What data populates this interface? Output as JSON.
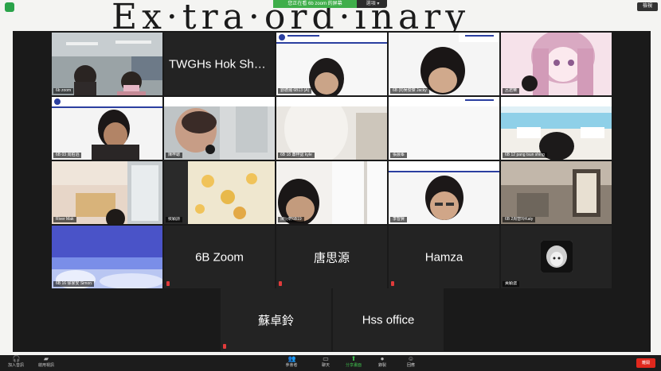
{
  "whiteboard_text": "Ex·tra·ord·inary",
  "share_bar": {
    "status": "您正在看 6b zoom 的屏幕",
    "options": "選項 ▾"
  },
  "top_right": {
    "label": "檢視"
  },
  "tiles": [
    {
      "name": "6b zoom",
      "type": "video"
    },
    {
      "name": "TWGHs Hok Shan...",
      "type": "name"
    },
    {
      "name": "劉德瀚 6B13 (A)",
      "type": "video"
    },
    {
      "name": "6B (8)吳俊傑 Jacky",
      "type": "video"
    },
    {
      "name": "呂君樂",
      "type": "video"
    },
    {
      "name": "6B 03 周柏滔",
      "type": "video"
    },
    {
      "name": "陳梓聰",
      "type": "video"
    },
    {
      "name": "6B 18 蕭梓認 kyle",
      "type": "video"
    },
    {
      "name": "張晨峯",
      "type": "video"
    },
    {
      "name": "6B 12 pang tsun shing",
      "type": "video"
    },
    {
      "name": "River Mak",
      "type": "video"
    },
    {
      "name": "侯穎詩",
      "type": "video"
    },
    {
      "name": "陳衍軒6B19",
      "type": "video"
    },
    {
      "name": "李智賢",
      "type": "video"
    },
    {
      "name": "6B 2周智玲Katy",
      "type": "video"
    },
    {
      "name": "6B 16 徐家安 Simon",
      "type": "video"
    },
    {
      "name": "6B Zoom",
      "type": "name"
    },
    {
      "name": "唐思源",
      "type": "name"
    },
    {
      "name": "Hamza",
      "type": "name"
    },
    {
      "name": "黃穎濃",
      "type": "avatar"
    },
    {
      "name": "蘇卓鈴",
      "type": "name"
    },
    {
      "name": "Hss office",
      "type": "name"
    }
  ],
  "toolbar": {
    "audio": "加入音訊",
    "video": "啟用視訊",
    "participants": "參會者",
    "participants_count": "22",
    "chat": "聊天",
    "share": "分享畫面",
    "record": "錄製",
    "reactions": "回應",
    "end": "離開"
  },
  "colors": {
    "accent": "#3fbf4d",
    "active_speaker": "#d8dc3c",
    "end": "#e0281d"
  }
}
